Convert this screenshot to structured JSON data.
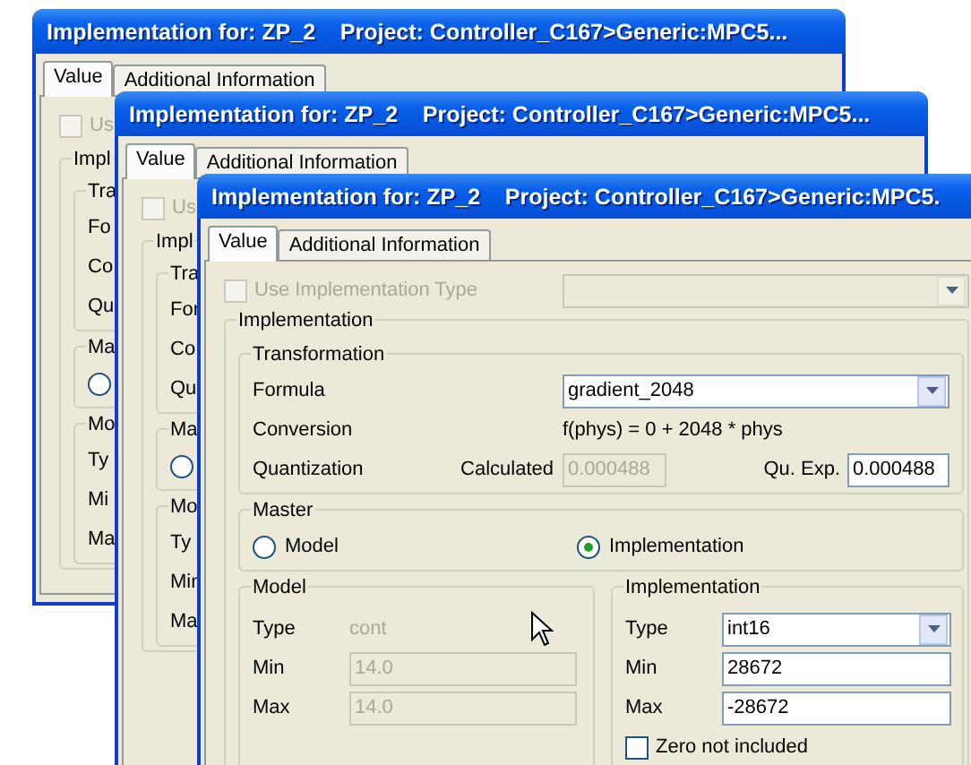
{
  "windows": [
    {
      "kind": "back",
      "title": "Implementation for: ZP_2    Project: Controller_C167>Generic:MPC5...",
      "tabs": [
        {
          "label": "Value",
          "selected": true
        },
        {
          "label": "Additional Information",
          "selected": false
        }
      ],
      "body": [
        {
          "kind": "checkbox",
          "text": "Us",
          "checked": false,
          "disabled": true
        },
        {
          "kind": "group",
          "label": "Impl",
          "children": [
            {
              "kind": "group",
              "label": "Tra",
              "children": [
                {
                  "kind": "label",
                  "text": "Fo"
                },
                {
                  "kind": "label",
                  "text": "Co"
                },
                {
                  "kind": "label",
                  "text": "Qu"
                }
              ]
            },
            {
              "kind": "group",
              "label": "Ma",
              "children": [
                {
                  "kind": "radio",
                  "selected": false
                }
              ]
            },
            {
              "kind": "group",
              "label": "Mo",
              "children": [
                {
                  "kind": "label",
                  "text": "Ty"
                },
                {
                  "kind": "label",
                  "text": "Mi"
                },
                {
                  "kind": "label",
                  "text": "Ma"
                }
              ]
            }
          ]
        }
      ]
    },
    {
      "kind": "back",
      "title": "Implementation for: ZP_2    Project: Controller_C167>Generic:MPC5...",
      "tabs": [
        {
          "label": "Value",
          "selected": true
        },
        {
          "label": "Additional Information",
          "selected": false
        }
      ],
      "body": [
        {
          "kind": "checkbox",
          "text": "Us",
          "checked": false,
          "disabled": true
        },
        {
          "kind": "group",
          "label": "Impl",
          "children": [
            {
              "kind": "group",
              "label": "Tra",
              "children": [
                {
                  "kind": "label",
                  "text": "For"
                },
                {
                  "kind": "label",
                  "text": "Co"
                },
                {
                  "kind": "label",
                  "text": "Qu"
                }
              ]
            },
            {
              "kind": "group",
              "label": "Ma",
              "children": [
                {
                  "kind": "radio",
                  "selected": false
                }
              ]
            },
            {
              "kind": "group",
              "label": "Mo",
              "children": [
                {
                  "kind": "label",
                  "text": "Ty"
                },
                {
                  "kind": "label",
                  "text": "Min"
                },
                {
                  "kind": "label",
                  "text": "Ma"
                }
              ]
            }
          ]
        }
      ]
    },
    {
      "kind": "front",
      "title": "Implementation for: ZP_2    Project: Controller_C167>Generic:MPC5.",
      "tabs": [
        {
          "label": "Value",
          "selected": true
        },
        {
          "label": "Additional Information",
          "selected": false
        }
      ],
      "use_type": {
        "text": "Use Implementation Type",
        "checked": false,
        "disabled": true
      },
      "type_select": {
        "disabled": true
      },
      "implementation_label": "Implementation",
      "transformation": {
        "label": "Transformation",
        "formula": {
          "label": "Formula",
          "value": "gradient_2048"
        },
        "conversion": {
          "label": "Conversion",
          "value": "f(phys) = 0 + 2048 * phys"
        },
        "quantization": {
          "label": "Quantization",
          "calculated_label": "Calculated",
          "calculated_value": "0.000488",
          "qu_exp_label": "Qu. Exp.",
          "qu_exp_value": "0.000488"
        }
      },
      "master": {
        "label": "Master",
        "options": [
          {
            "label": "Model",
            "selected": false
          },
          {
            "label": "Implementation",
            "selected": true
          }
        ]
      },
      "model": {
        "label": "Model",
        "type_label": "Type",
        "type_value": "cont",
        "min_label": "Min",
        "min_value": "14.0",
        "max_label": "Max",
        "max_value": "14.0"
      },
      "impl": {
        "label": "Implementation",
        "type_label": "Type",
        "type_value": "int16",
        "min_label": "Min",
        "min_value": "28672",
        "max_label": "Max",
        "max_value": "-28672",
        "zero": {
          "text": "Zero not included",
          "checked": false
        }
      }
    }
  ]
}
